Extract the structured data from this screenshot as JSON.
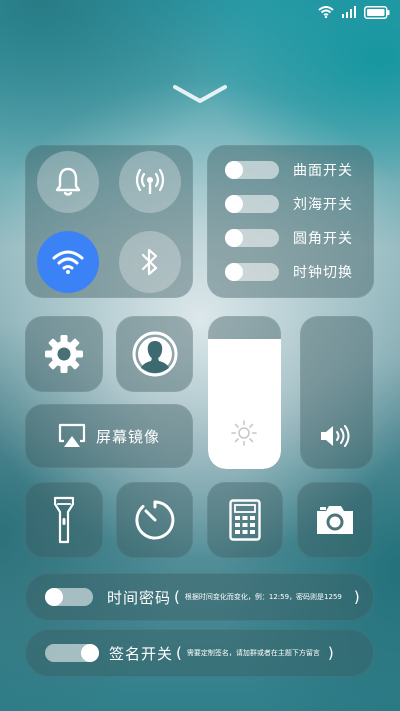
{
  "connectivity": {
    "bell_icon": "bell-icon",
    "hotspot_icon": "hotspot-icon",
    "wifi_icon": "wifi-icon",
    "bluetooth_icon": "bluetooth-icon",
    "wifi_color": "#3b82f6"
  },
  "toggles": [
    {
      "label": "曲面开关",
      "on": false
    },
    {
      "label": "刘海开关",
      "on": false
    },
    {
      "label": "圆角开关",
      "on": false
    },
    {
      "label": "时钟切换",
      "on": false
    }
  ],
  "mirror": {
    "label": "屏幕镜像"
  },
  "brightness": {
    "level": 0.85
  },
  "volume": {
    "level": 0.0
  },
  "time_password": {
    "label": "时间密码",
    "open_paren": "(",
    "hint": "根据时间变化而变化，例：12:59，密码则是1259",
    "close_paren": ")",
    "on": false
  },
  "signature": {
    "label": "签名开关",
    "open_paren": "(",
    "hint": "需要定制签名，请加群或者在主题下方留言",
    "close_paren": ")",
    "on": true
  }
}
